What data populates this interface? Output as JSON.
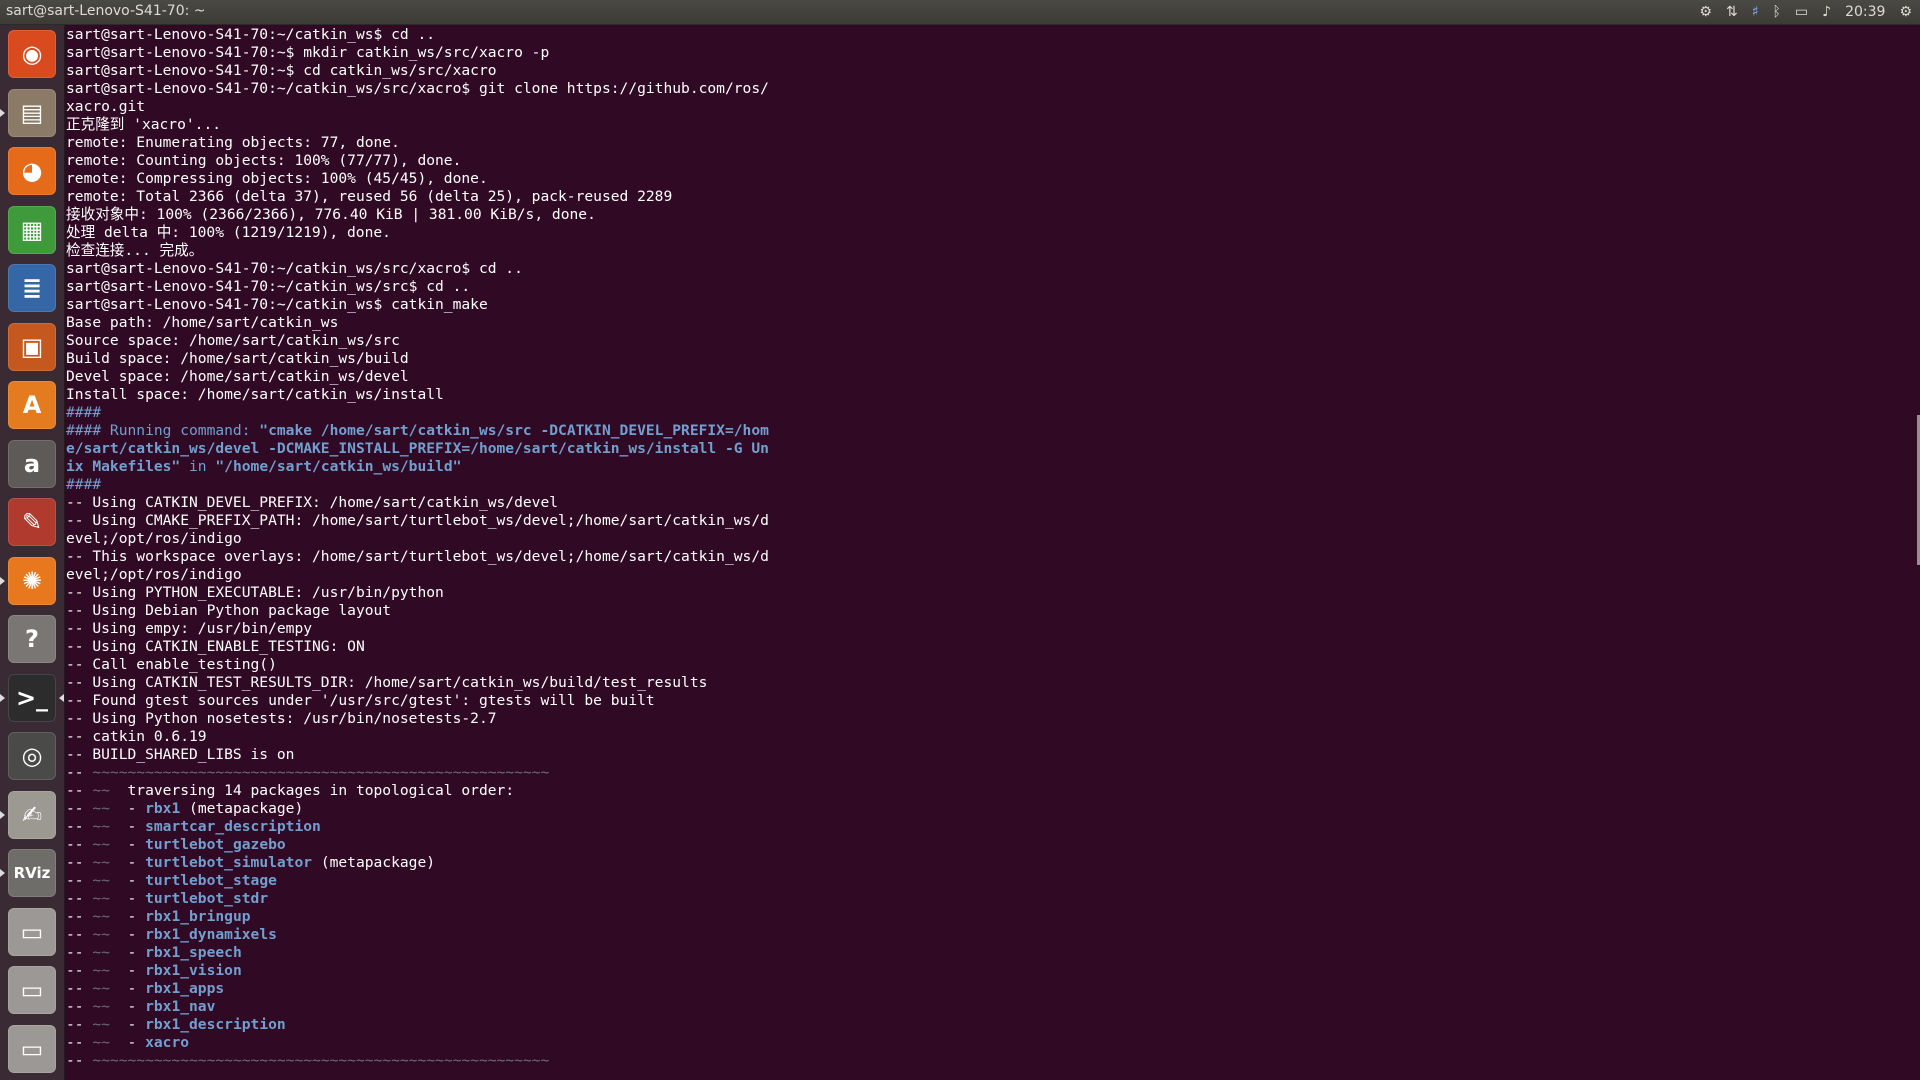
{
  "window": {
    "title": "sart@sart-Lenovo-S41-70: ~"
  },
  "tray": {
    "clock": "20:39"
  },
  "launcher": {
    "items": [
      {
        "name": "dash",
        "glyph": "◉",
        "bg": "#d94b1f"
      },
      {
        "name": "files",
        "glyph": "▤",
        "bg": "#8a7a66"
      },
      {
        "name": "firefox",
        "glyph": "◕",
        "bg": "#e56a1a"
      },
      {
        "name": "calc",
        "glyph": "▦",
        "bg": "#3f9a3c"
      },
      {
        "name": "writer",
        "glyph": "≣",
        "bg": "#3566a6"
      },
      {
        "name": "impress",
        "glyph": "▣",
        "bg": "#c4581f"
      },
      {
        "name": "software-center",
        "glyph": "A",
        "bg": "#e47b1e"
      },
      {
        "name": "amazon",
        "glyph": "a",
        "bg": "#5e5a58"
      },
      {
        "name": "system-settings",
        "glyph": "✎",
        "bg": "#b03a2e"
      },
      {
        "name": "updater",
        "glyph": "✺",
        "bg": "#e8781e"
      },
      {
        "name": "help",
        "glyph": "?",
        "bg": "#7a7673"
      },
      {
        "name": "terminal",
        "glyph": ">_",
        "bg": "#2c2c2c"
      },
      {
        "name": "eye",
        "glyph": "◎",
        "bg": "#4a4a48"
      },
      {
        "name": "text-editor",
        "glyph": "✍",
        "bg": "#9c9892"
      },
      {
        "name": "rviz",
        "glyph": "RViz",
        "bg": "#6e6d6a"
      },
      {
        "name": "drive1",
        "glyph": "▭",
        "bg": "#9b9895"
      },
      {
        "name": "drive2",
        "glyph": "▭",
        "bg": "#9b9895"
      },
      {
        "name": "drive3",
        "glyph": "▭",
        "bg": "#9b9895"
      }
    ]
  },
  "terminal": {
    "lines": [
      [
        {
          "t": "sart@sart-Lenovo-S41-70:~/catkin_ws$ cd .."
        }
      ],
      [
        {
          "t": "sart@sart-Lenovo-S41-70:~$ mkdir catkin_ws/src/xacro -p"
        }
      ],
      [
        {
          "t": "sart@sart-Lenovo-S41-70:~$ cd catkin_ws/src/xacro"
        }
      ],
      [
        {
          "t": "sart@sart-Lenovo-S41-70:~/catkin_ws/src/xacro$ git clone https://github.com/ros/"
        }
      ],
      [
        {
          "t": "xacro.git"
        }
      ],
      [
        {
          "t": "正克隆到 'xacro'..."
        }
      ],
      [
        {
          "t": "remote: Enumerating objects: 77, done."
        }
      ],
      [
        {
          "t": "remote: Counting objects: 100% (77/77), done."
        }
      ],
      [
        {
          "t": "remote: Compressing objects: 100% (45/45), done."
        }
      ],
      [
        {
          "t": "remote: Total 2366 (delta 37), reused 56 (delta 25), pack-reused 2289"
        }
      ],
      [
        {
          "t": "接收对象中: 100% (2366/2366), 776.40 KiB | 381.00 KiB/s, done."
        }
      ],
      [
        {
          "t": "处理 delta 中: 100% (1219/1219), done."
        }
      ],
      [
        {
          "t": "检查连接... 完成。"
        }
      ],
      [
        {
          "t": "sart@sart-Lenovo-S41-70:~/catkin_ws/src/xacro$ cd .."
        }
      ],
      [
        {
          "t": "sart@sart-Lenovo-S41-70:~/catkin_ws/src$ cd .."
        }
      ],
      [
        {
          "t": "sart@sart-Lenovo-S41-70:~/catkin_ws$ catkin_make"
        }
      ],
      [
        {
          "t": "Base path: /home/sart/catkin_ws"
        }
      ],
      [
        {
          "t": "Source space: /home/sart/catkin_ws/src"
        }
      ],
      [
        {
          "t": "Build space: /home/sart/catkin_ws/build"
        }
      ],
      [
        {
          "t": "Devel space: /home/sart/catkin_ws/devel"
        }
      ],
      [
        {
          "t": "Install space: /home/sart/catkin_ws/install"
        }
      ],
      [
        {
          "t": "####",
          "c": "blue"
        }
      ],
      [
        {
          "t": "#### Running command: ",
          "c": "blue"
        },
        {
          "t": "\"cmake /home/sart/catkin_ws/src -DCATKIN_DEVEL_PREFIX=/hom",
          "c": "bb"
        }
      ],
      [
        {
          "t": "e/sart/catkin_ws/devel -DCMAKE_INSTALL_PREFIX=/home/sart/catkin_ws/install -G Un",
          "c": "bb"
        }
      ],
      [
        {
          "t": "ix Makefiles\"",
          "c": "bb"
        },
        {
          "t": " in ",
          "c": "blue"
        },
        {
          "t": "\"/home/sart/catkin_ws/build\"",
          "c": "bb"
        }
      ],
      [
        {
          "t": "####",
          "c": "blue"
        }
      ],
      [
        {
          "t": "-- Using CATKIN_DEVEL_PREFIX: /home/sart/catkin_ws/devel"
        }
      ],
      [
        {
          "t": "-- Using CMAKE_PREFIX_PATH: /home/sart/turtlebot_ws/devel;/home/sart/catkin_ws/d"
        }
      ],
      [
        {
          "t": "evel;/opt/ros/indigo"
        }
      ],
      [
        {
          "t": "-- This workspace overlays: /home/sart/turtlebot_ws/devel;/home/sart/catkin_ws/d"
        }
      ],
      [
        {
          "t": "evel;/opt/ros/indigo"
        }
      ],
      [
        {
          "t": "-- Using PYTHON_EXECUTABLE: /usr/bin/python"
        }
      ],
      [
        {
          "t": "-- Using Debian Python package layout"
        }
      ],
      [
        {
          "t": "-- Using empy: /usr/bin/empy"
        }
      ],
      [
        {
          "t": "-- Using CATKIN_ENABLE_TESTING: ON"
        }
      ],
      [
        {
          "t": "-- Call enable_testing()"
        }
      ],
      [
        {
          "t": "-- Using CATKIN_TEST_RESULTS_DIR: /home/sart/catkin_ws/build/test_results"
        }
      ],
      [
        {
          "t": "-- Found gtest sources under '/usr/src/gtest': gtests will be built"
        }
      ],
      [
        {
          "t": "-- Using Python nosetests: /usr/bin/nosetests-2.7"
        }
      ],
      [
        {
          "t": "-- catkin 0.6.19"
        }
      ],
      [
        {
          "t": "-- BUILD_SHARED_LIBS is on"
        }
      ],
      [
        {
          "t": "-- "
        },
        {
          "t": "~~~~~~~~~~~~~~~~~~~~~~~~~~~~~~~~~~~~~~~~~~~~~~~~~~~~",
          "c": "dim"
        }
      ],
      [
        {
          "t": "-- "
        },
        {
          "t": "~~",
          "c": "dim"
        },
        {
          "t": "  traversing 14 packages in topological order:"
        }
      ],
      [
        {
          "t": "-- "
        },
        {
          "t": "~~",
          "c": "dim"
        },
        {
          "t": "  - "
        },
        {
          "t": "rbx1",
          "c": "bb"
        },
        {
          "t": " (metapackage)"
        }
      ],
      [
        {
          "t": "-- "
        },
        {
          "t": "~~",
          "c": "dim"
        },
        {
          "t": "  - "
        },
        {
          "t": "smartcar_description",
          "c": "bb"
        }
      ],
      [
        {
          "t": "-- "
        },
        {
          "t": "~~",
          "c": "dim"
        },
        {
          "t": "  - "
        },
        {
          "t": "turtlebot_gazebo",
          "c": "bb"
        }
      ],
      [
        {
          "t": "-- "
        },
        {
          "t": "~~",
          "c": "dim"
        },
        {
          "t": "  - "
        },
        {
          "t": "turtlebot_simulator",
          "c": "bb"
        },
        {
          "t": " (metapackage)"
        }
      ],
      [
        {
          "t": "-- "
        },
        {
          "t": "~~",
          "c": "dim"
        },
        {
          "t": "  - "
        },
        {
          "t": "turtlebot_stage",
          "c": "bb"
        }
      ],
      [
        {
          "t": "-- "
        },
        {
          "t": "~~",
          "c": "dim"
        },
        {
          "t": "  - "
        },
        {
          "t": "turtlebot_stdr",
          "c": "bb"
        }
      ],
      [
        {
          "t": "-- "
        },
        {
          "t": "~~",
          "c": "dim"
        },
        {
          "t": "  - "
        },
        {
          "t": "rbx1_bringup",
          "c": "bb"
        }
      ],
      [
        {
          "t": "-- "
        },
        {
          "t": "~~",
          "c": "dim"
        },
        {
          "t": "  - "
        },
        {
          "t": "rbx1_dynamixels",
          "c": "bb"
        }
      ],
      [
        {
          "t": "-- "
        },
        {
          "t": "~~",
          "c": "dim"
        },
        {
          "t": "  - "
        },
        {
          "t": "rbx1_speech",
          "c": "bb"
        }
      ],
      [
        {
          "t": "-- "
        },
        {
          "t": "~~",
          "c": "dim"
        },
        {
          "t": "  - "
        },
        {
          "t": "rbx1_vision",
          "c": "bb"
        }
      ],
      [
        {
          "t": "-- "
        },
        {
          "t": "~~",
          "c": "dim"
        },
        {
          "t": "  - "
        },
        {
          "t": "rbx1_apps",
          "c": "bb"
        }
      ],
      [
        {
          "t": "-- "
        },
        {
          "t": "~~",
          "c": "dim"
        },
        {
          "t": "  - "
        },
        {
          "t": "rbx1_nav",
          "c": "bb"
        }
      ],
      [
        {
          "t": "-- "
        },
        {
          "t": "~~",
          "c": "dim"
        },
        {
          "t": "  - "
        },
        {
          "t": "rbx1_description",
          "c": "bb"
        }
      ],
      [
        {
          "t": "-- "
        },
        {
          "t": "~~",
          "c": "dim"
        },
        {
          "t": "  - "
        },
        {
          "t": "xacro",
          "c": "bb"
        }
      ],
      [
        {
          "t": "-- "
        },
        {
          "t": "~~~~~~~~~~~~~~~~~~~~~~~~~~~~~~~~~~~~~~~~~~~~~~~~~~~~",
          "c": "dim"
        }
      ]
    ]
  }
}
